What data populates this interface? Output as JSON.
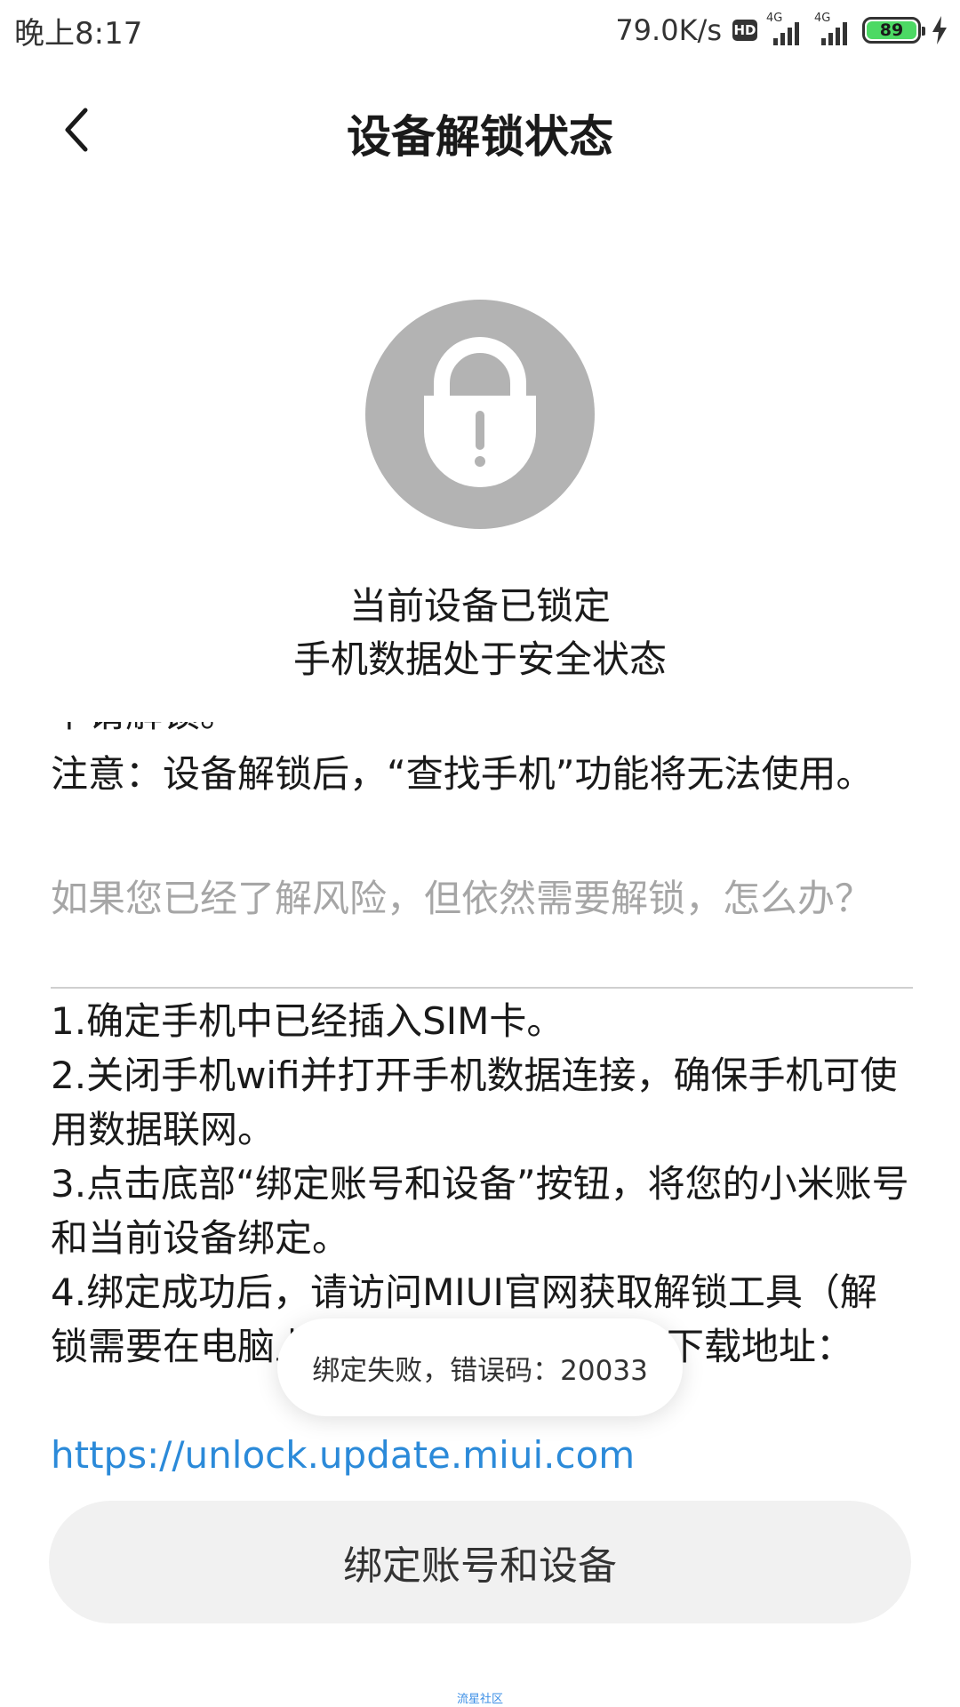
{
  "status_bar": {
    "time": "晚上8:17",
    "net_speed": "79.0K/s",
    "hd_label": "HD",
    "signal1_label": "4G",
    "signal2_label": "4G",
    "battery_level": "89"
  },
  "header": {
    "title": "设备解锁状态",
    "back_icon": "chevron-left-icon"
  },
  "lock": {
    "icon": "padlock-exclamation-icon",
    "color": "#b3b3b3"
  },
  "device_status": {
    "line1": "当前设备已锁定",
    "line2": "手机数据处于安全状态"
  },
  "description": {
    "clipped_line": "申请解锁。",
    "note": "注意：设备解锁后，“查找手机”功能将无法使用。",
    "faq_question": "如果您已经了解风险，但依然需要解锁，怎么办？",
    "steps": [
      "1.确定手机中已经插入SIM卡。",
      "2.关闭手机wifi并打开手机数据连接，确保手机可使用数据联网。",
      "3.点击底部“绑定账号和设备”按钮，将您的小米账号和当前设备绑定。",
      "4.绑定成功后，请访问MIUI官网获取解锁工具（解锁需要在电脑上进行操作），解锁工具下载地址："
    ],
    "link": "https://unlock.update.miui.com"
  },
  "toast": {
    "message": "绑定失败，错误码：20033"
  },
  "bottom_button": {
    "label": "绑定账号和设备"
  },
  "watermark": "流星社区",
  "colors": {
    "link": "#2b8ad9",
    "battery": "#4cd964",
    "muted_text": "#a6a6a6",
    "button_bg": "#f1f1f1"
  }
}
